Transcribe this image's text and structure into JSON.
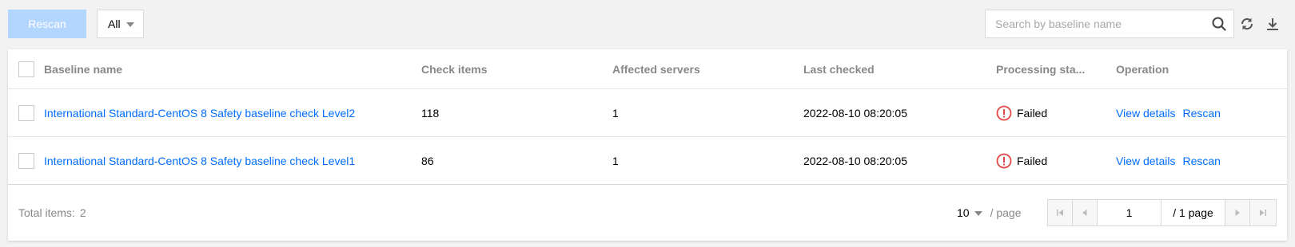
{
  "toolbar": {
    "rescan_label": "Rescan",
    "filter_value": "All",
    "search_placeholder": "Search by baseline name"
  },
  "table": {
    "columns": [
      "Baseline name",
      "Check items",
      "Affected servers",
      "Last checked",
      "Processing sta...",
      "Operation"
    ],
    "rows": [
      {
        "name": "International Standard-CentOS 8 Safety baseline check Level2",
        "check_items": "118",
        "affected_servers": "1",
        "last_checked": "2022-08-10 08:20:05",
        "status": "Failed",
        "op_view": "View details",
        "op_rescan": "Rescan"
      },
      {
        "name": "International Standard-CentOS 8 Safety baseline check Level1",
        "check_items": "86",
        "affected_servers": "1",
        "last_checked": "2022-08-10 08:20:05",
        "status": "Failed",
        "op_view": "View details",
        "op_rescan": "Rescan"
      }
    ]
  },
  "footer": {
    "total_label": "Total items:",
    "total_count": "2",
    "page_size": "10",
    "page_size_unit": "/ page",
    "current_page": "1",
    "total_pages": "/ 1 page"
  },
  "colors": {
    "link": "#006eff",
    "failed": "#e54545",
    "rescan_button_bg": "#b3d6ff"
  },
  "icons": {
    "search": "search-icon",
    "refresh": "refresh-icon",
    "download": "download-icon",
    "status": "error-circle-icon"
  }
}
